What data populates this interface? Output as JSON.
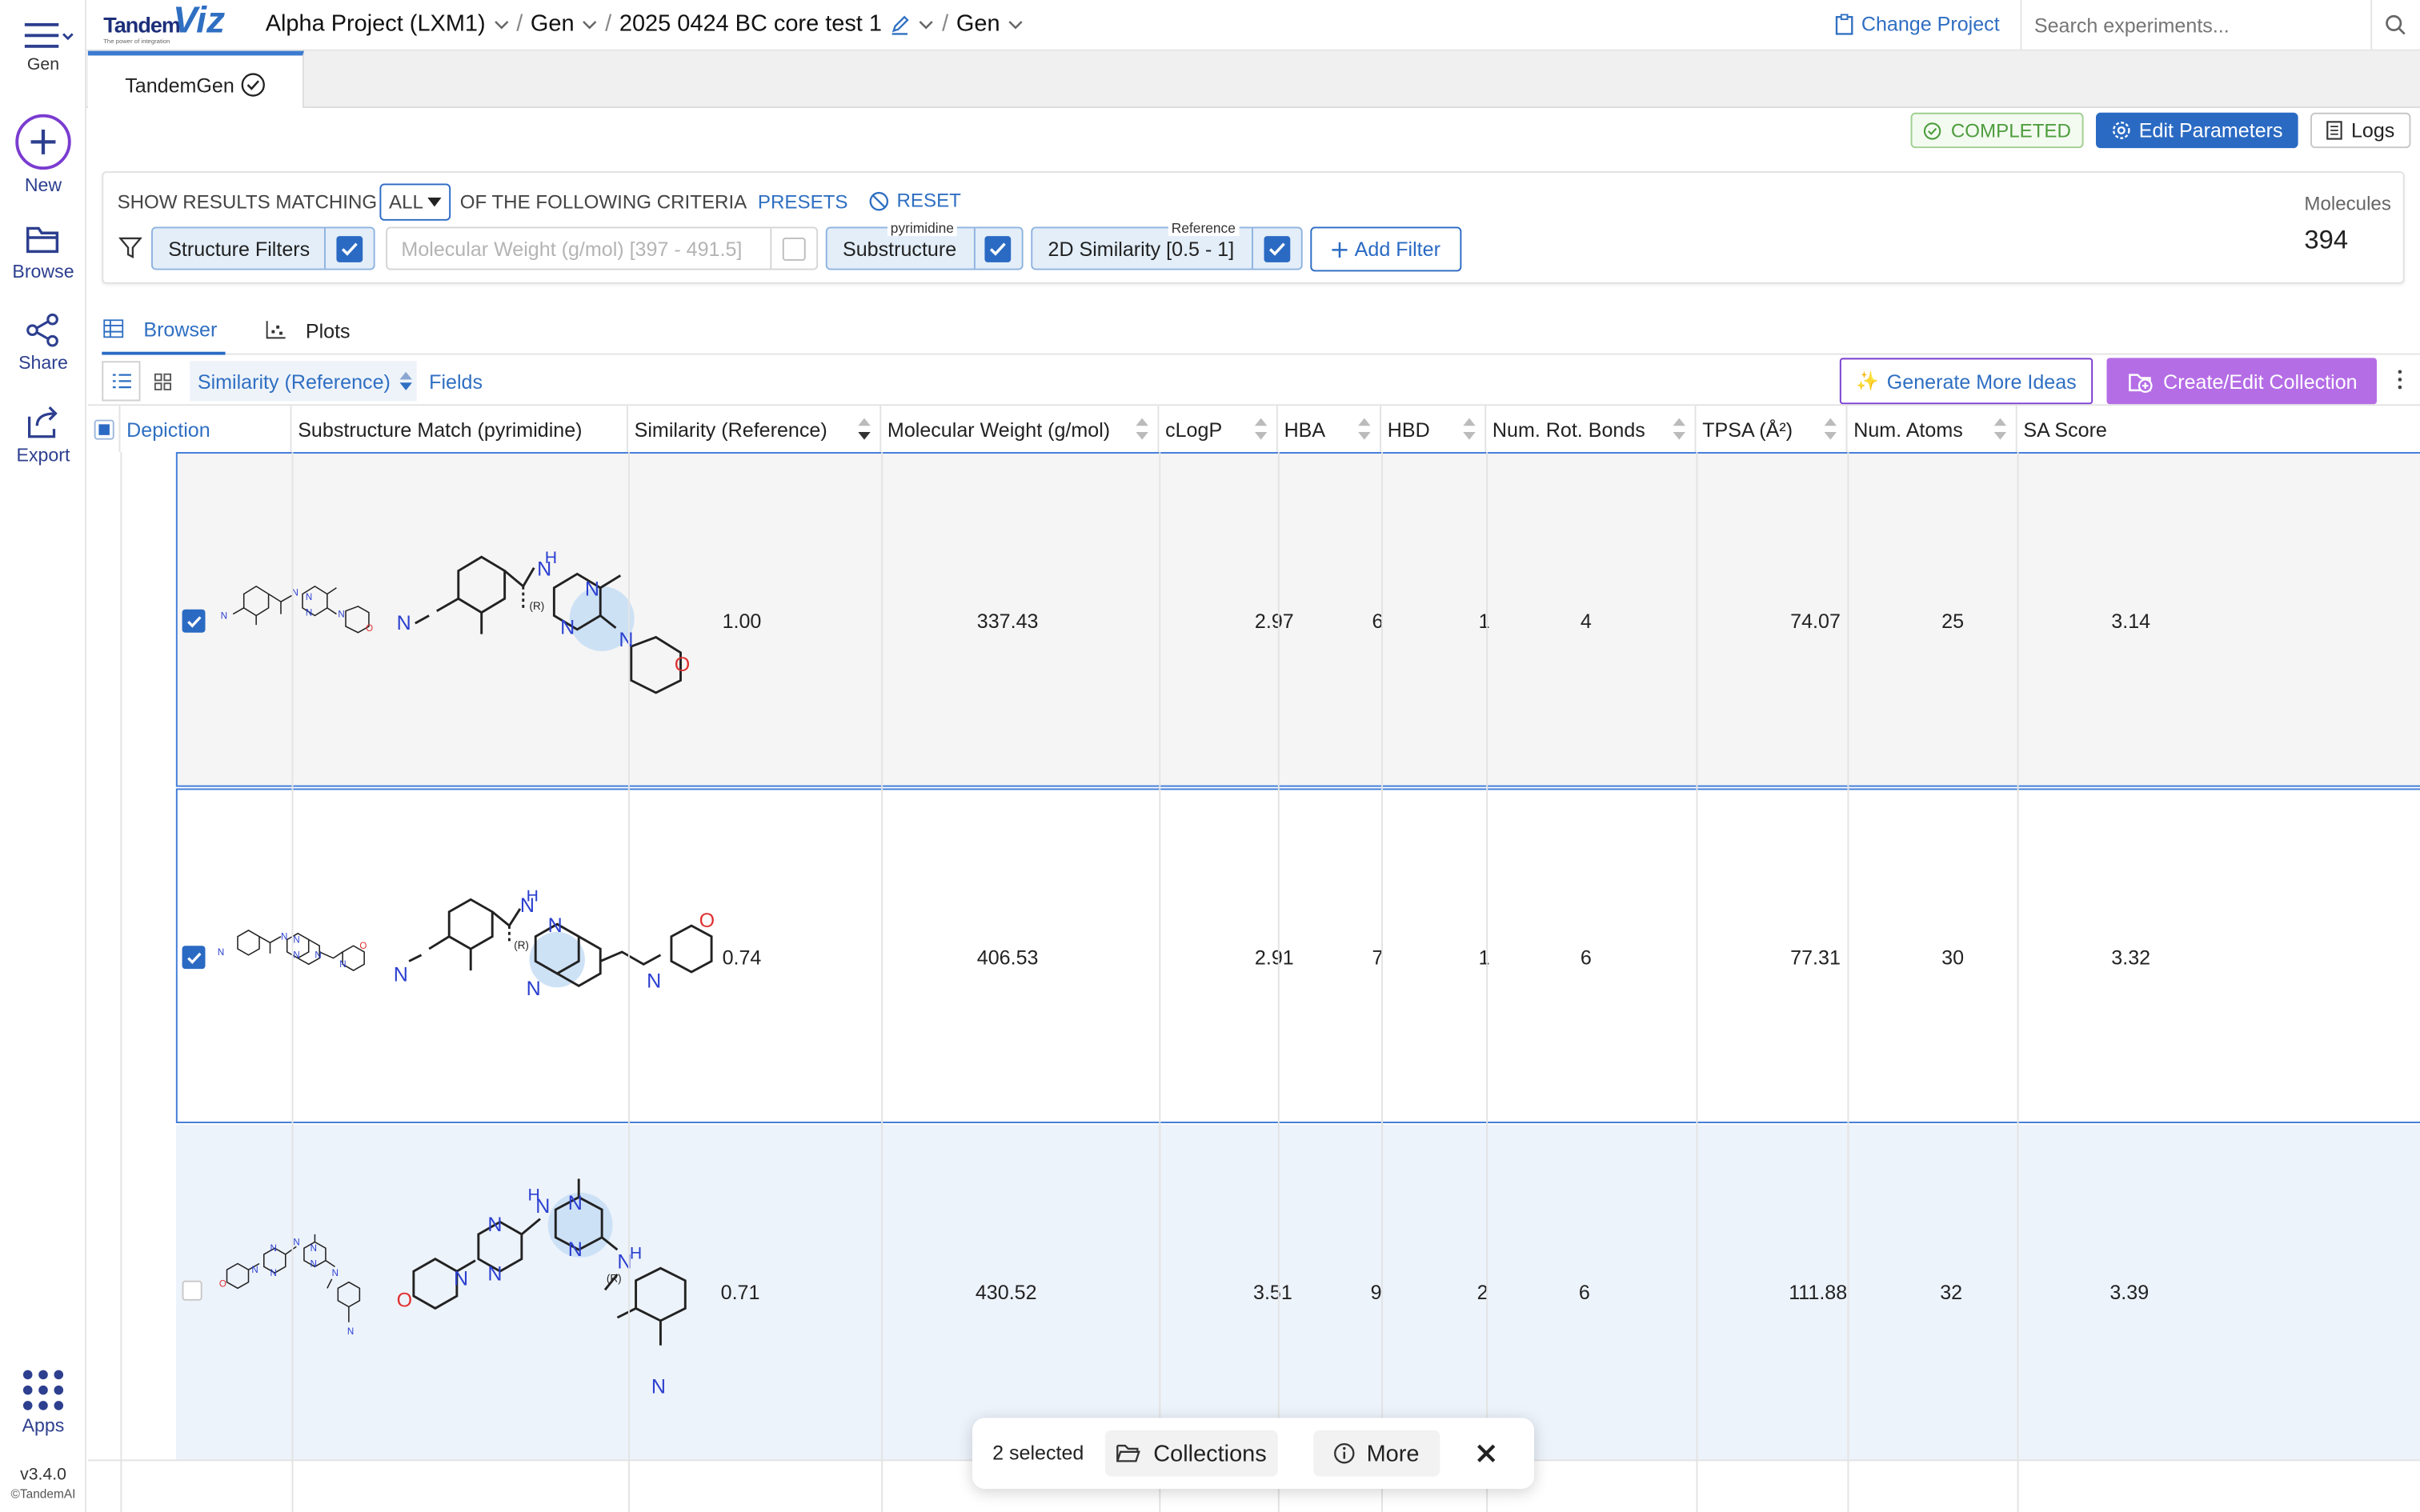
{
  "sidebar": {
    "menu_label": "Gen",
    "new_label": "New",
    "browse_label": "Browse",
    "share_label": "Share",
    "export_label": "Export",
    "apps_label": "Apps",
    "version": "v3.4.0",
    "copyright": "©TandemAI"
  },
  "logo": {
    "brand": "Tandem",
    "product": "Viz",
    "tagline": "The power of integration"
  },
  "breadcrumb": {
    "project": "Alpha Project (LXM1)",
    "module": "Gen",
    "experiment": "2025 0424 BC core test 1",
    "view": "Gen",
    "separator": "/"
  },
  "header": {
    "change_project": "Change Project",
    "search_placeholder": "Search experiments..."
  },
  "tabs": [
    {
      "label": "TandemGen"
    }
  ],
  "status": {
    "badge": "COMPLETED",
    "edit_parameters": "Edit Parameters",
    "logs": "Logs"
  },
  "filters": {
    "show_results_prefix": "SHOW RESULTS MATCHING",
    "match_mode": "ALL",
    "show_results_suffix": "OF THE FOLLOWING CRITERIA",
    "presets": "PRESETS",
    "reset": "RESET",
    "structure_filters": "Structure Filters",
    "mw_filter": "Molecular Weight (g/mol) [397 - 491.5]",
    "substructure_tag": "pyrimidine",
    "substructure": "Substructure",
    "similarity_tag": "Reference",
    "similarity": "2D Similarity [0.5 - 1]",
    "add_filter": "Add Filter",
    "molecules_label": "Molecules",
    "molecules_count": "394"
  },
  "view_tabs": {
    "browser": "Browser",
    "plots": "Plots"
  },
  "toolbar": {
    "sort_field": "Similarity (Reference)",
    "fields": "Fields",
    "generate_more": "Generate More Ideas",
    "create_collection": "Create/Edit Collection"
  },
  "table": {
    "columns": [
      "Depiction",
      "Substructure Match (pyrimidine)",
      "Similarity (Reference)",
      "Molecular Weight (g/mol)",
      "cLogP",
      "HBA",
      "HBD",
      "Num. Rot. Bonds",
      "TPSA (Å²)",
      "Num. Atoms",
      "SA Score"
    ],
    "rows": [
      {
        "selected": true,
        "similarity": "1.00",
        "mw": "337.43",
        "clogp": "2.97",
        "hba": "6",
        "hbd": "1",
        "rot": "4",
        "tpsa": "74.07",
        "atoms": "25",
        "sa": "3.14"
      },
      {
        "selected": true,
        "similarity": "0.74",
        "mw": "406.53",
        "clogp": "2.91",
        "hba": "7",
        "hbd": "1",
        "rot": "6",
        "tpsa": "77.31",
        "atoms": "30",
        "sa": "3.32"
      },
      {
        "selected": false,
        "similarity": "0.71",
        "mw": "430.52",
        "clogp": "3.51",
        "hba": "9",
        "hbd": "2",
        "rot": "6",
        "tpsa": "111.88",
        "atoms": "32",
        "sa": "3.39"
      }
    ]
  },
  "selection_bar": {
    "selected_text": "2 selected",
    "collections": "Collections",
    "more": "More"
  },
  "colors": {
    "primary": "#2a6ac3",
    "link": "#2f6fc2",
    "completed": "#5aa84a",
    "collection_button": "#b56de6",
    "selected_row_border": "#3f7cd8",
    "highlight_row": "#edf3fb"
  }
}
